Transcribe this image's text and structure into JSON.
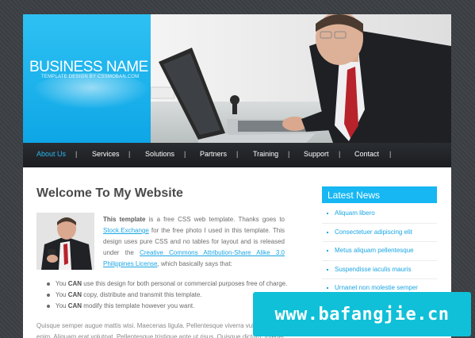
{
  "header": {
    "brand_name": "BUSINESS NAME",
    "brand_tagline": "TEMPLATE DESIGN BY CSSMOBAN.COM"
  },
  "nav": {
    "items": [
      {
        "label": "About Us",
        "active": true
      },
      {
        "label": "Services"
      },
      {
        "label": "Solutions"
      },
      {
        "label": "Partners"
      },
      {
        "label": "Training"
      },
      {
        "label": "Support"
      },
      {
        "label": "Contact"
      }
    ],
    "separator": "|"
  },
  "main": {
    "title": "Welcome To My Website",
    "intro": {
      "bold_lead": "This template",
      "text_1": " is a free CSS web template. Thanks goes to ",
      "link_1": "Stock.Exchange",
      "text_2": " for the free photo I used in this template. This design uses pure CSS and no tables for layout and is released under the ",
      "link_2": "Creative Commons Attribution-Share Alike 3.0 Philippines License",
      "text_3": ", which basically says that:"
    },
    "bullets": [
      {
        "pre": "You ",
        "bold": "CAN",
        "post": " use this design for both personal or commercial purposes free of charge."
      },
      {
        "pre": "You ",
        "bold": "CAN",
        "post": " copy, distribute and transmit this template."
      },
      {
        "pre": "You ",
        "bold": "CAN",
        "post": " modify this template however you want."
      }
    ],
    "lorem": "Quisque semper augue mattis wisi. Maecenas ligula. Pellentesque viverra vulputate enim. Aliquam erat volutpat. Pellentesque tristique ante ut risus. Quisque dictum. Integer nisl"
  },
  "sidebar": {
    "title": "Latest News",
    "items": [
      "Aliquam libero",
      "Consectetuer adipiscing elit",
      "Metus aliquam pellentesque",
      "Suspendisse iaculis mauris",
      "Urnanet non molestie semper"
    ]
  },
  "watermark": {
    "text": "www.bafangjie.cn"
  },
  "colors": {
    "accent": "#16b7f2",
    "link": "#1aa6e4",
    "nav_bg": "#1f2124",
    "page_bg": "#3c3f44"
  }
}
